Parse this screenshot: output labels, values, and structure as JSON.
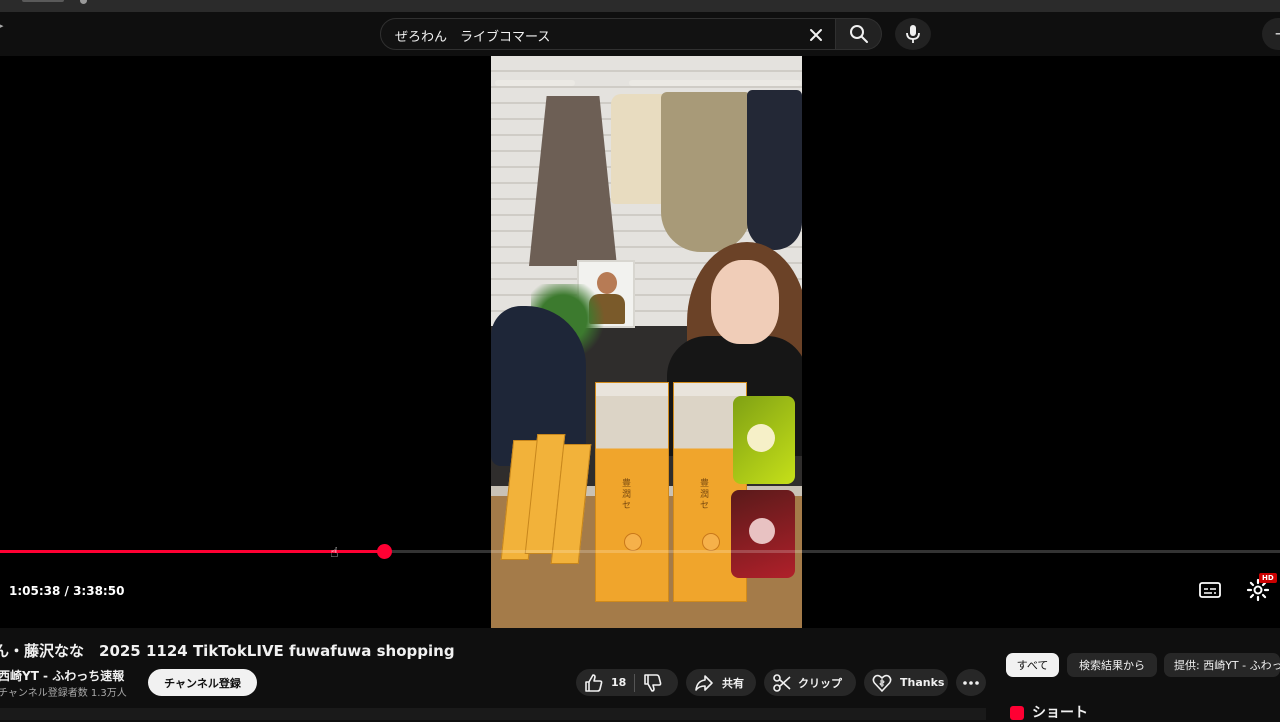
{
  "search": {
    "query": "ぜろわん　ライブコマース"
  },
  "player": {
    "time_display": "1:05:38 / 3:38:50",
    "progress": 0.3,
    "hd_label": "HD"
  },
  "video": {
    "title": "ん・藤沢なな　2025 1124 TikTokLIVE fuwafuwa shopping",
    "channel_name": "西崎YT - ふわっち速報",
    "subscriber_count": "チャンネル登録者数 1.3万人",
    "subscribe_label": "チャンネル登録",
    "like_count": "18",
    "share_label": "共有",
    "clip_label": "クリップ",
    "thanks_label": "Thanks"
  },
  "chips": {
    "all": "すべて",
    "from_search": "検索結果から",
    "from_channel": "提供: 西崎YT - ふわっ"
  },
  "sidebar": {
    "shorts_label": "ショート"
  },
  "colors": {
    "accent": "#ff0033",
    "background": "#0f0f0f",
    "pill": "#272727"
  },
  "icons": {
    "clear": "close-icon",
    "search": "search-icon",
    "mic": "mic-icon",
    "subtitles": "subtitles-icon",
    "settings": "gear-icon",
    "like": "thumbs-up-icon",
    "dislike": "thumbs-down-icon",
    "share": "share-icon",
    "clip": "scissors-icon",
    "thanks": "thanks-icon",
    "more": "more-icon"
  }
}
